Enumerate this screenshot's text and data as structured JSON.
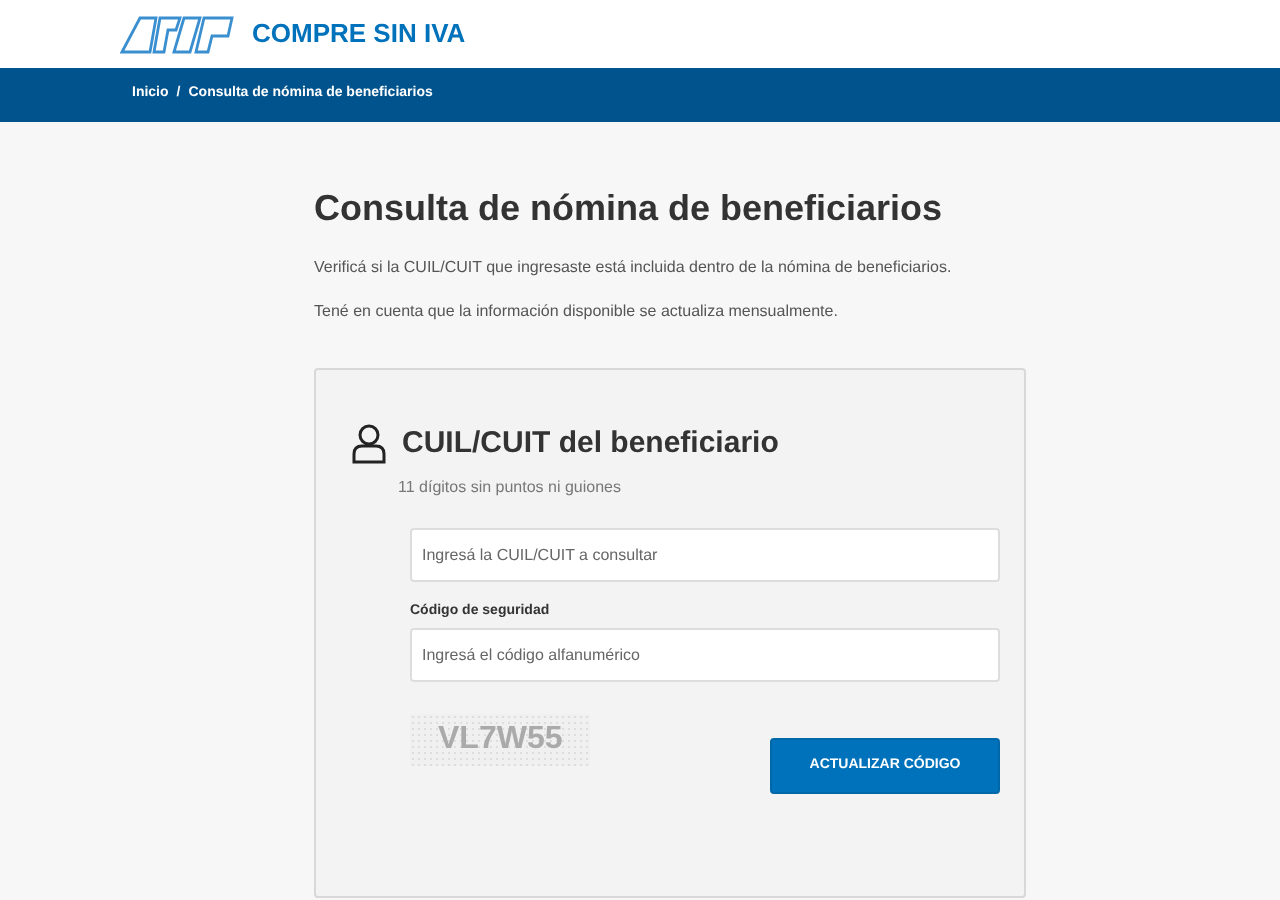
{
  "header": {
    "brand": "COMPRE SIN IVA"
  },
  "breadcrumb": {
    "separator": "/",
    "items": [
      {
        "label": "Inicio"
      },
      {
        "label": "Consulta de nómina de beneficiarios"
      }
    ]
  },
  "page": {
    "title": "Consulta de nómina de beneficiarios",
    "paragraphs": [
      "Verificá si la CUIL/CUIT que ingresaste está incluida dentro de la nómina de beneficiarios.",
      "Tené en cuenta que la información disponible se actualiza mensualmente."
    ]
  },
  "form": {
    "title": "CUIL/CUIT del beneficiario",
    "hint": "11 dígitos sin puntos ni guiones",
    "fields": [
      {
        "placeholder": "Ingresá la CUIL/CUIT a consultar"
      },
      {
        "label": "Código de seguridad",
        "placeholder": "Ingresá el código alfanumérico"
      }
    ],
    "captcha": "VL7W55",
    "refresh_button": "ACTUALIZAR CÓDIGO"
  }
}
